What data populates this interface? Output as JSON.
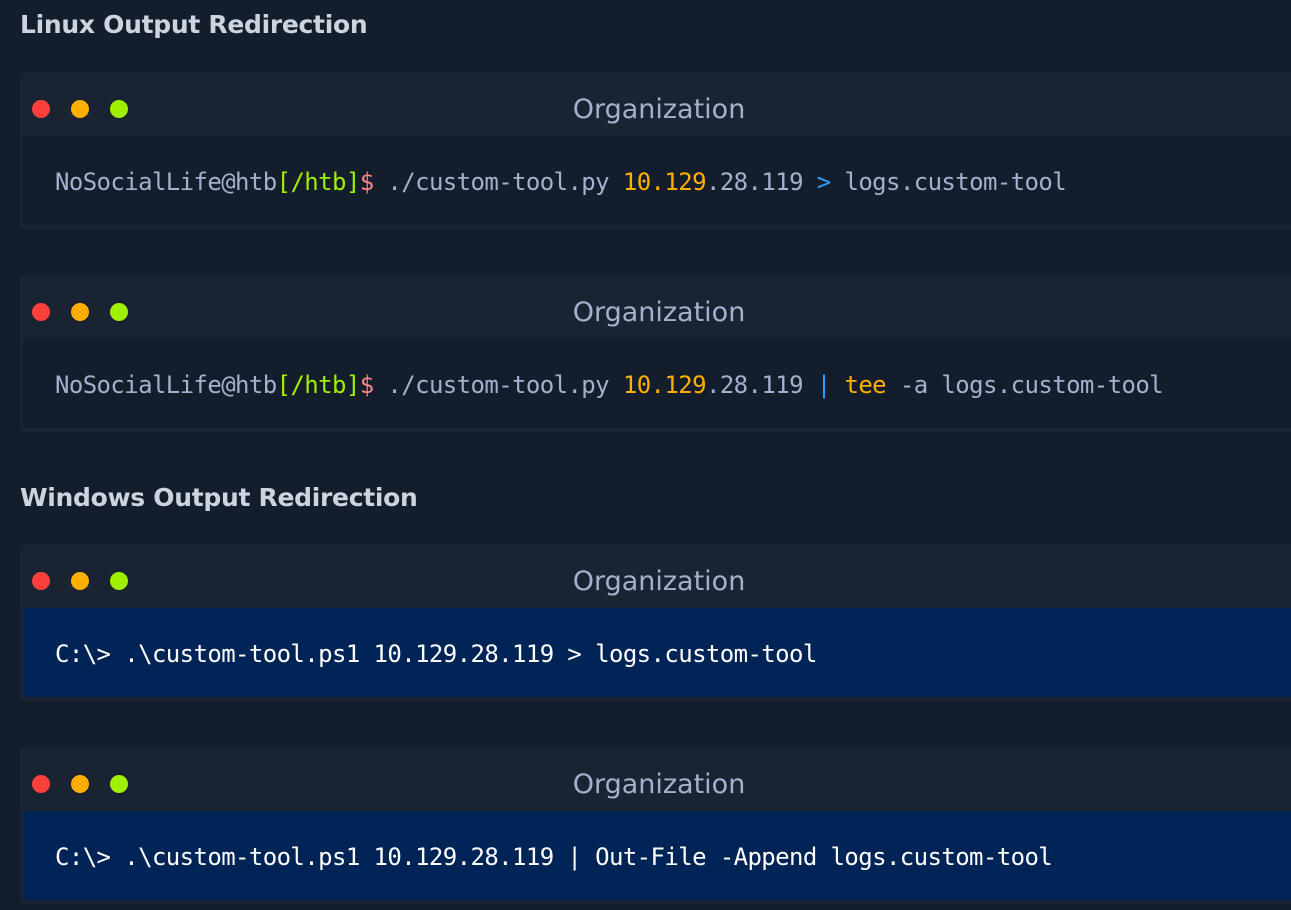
{
  "sections": {
    "linux_heading": "Linux Output Redirection",
    "windows_heading": "Windows Output Redirection"
  },
  "colors": {
    "background": "#141d2b",
    "panel": "#1a2332",
    "powershell_bg": "#012456",
    "dot_red": "#ff3e3e",
    "dot_yellow": "#ffaf00",
    "dot_green": "#9fef00",
    "dir_green": "#9fef00",
    "dollar_red": "#ff8484",
    "ip_orange": "#ffaf00",
    "op_blue": "#2e9dff"
  },
  "terminals": [
    {
      "title": "Organization",
      "prompt_user": "NoSocialLife@htb",
      "prompt_dir": "[/htb]",
      "prompt_dollar": "$",
      "cmd_script": " ./custom-tool.py ",
      "ip_a": "10.129",
      "ip_b": ".28.119 ",
      "operator": ">",
      "rest": " logs.custom-tool"
    },
    {
      "title": "Organization",
      "prompt_user": "NoSocialLife@htb",
      "prompt_dir": "[/htb]",
      "prompt_dollar": "$",
      "cmd_script": " ./custom-tool.py ",
      "ip_a": "10.129",
      "ip_b": ".28.119 ",
      "operator": "|",
      "tee": " tee",
      "rest": " -a logs.custom-tool"
    },
    {
      "title": "Organization",
      "command": "C:\\> .\\custom-tool.ps1 10.129.28.119 > logs.custom-tool"
    },
    {
      "title": "Organization",
      "command": "C:\\> .\\custom-tool.ps1 10.129.28.119 | Out-File -Append logs.custom-tool"
    }
  ]
}
